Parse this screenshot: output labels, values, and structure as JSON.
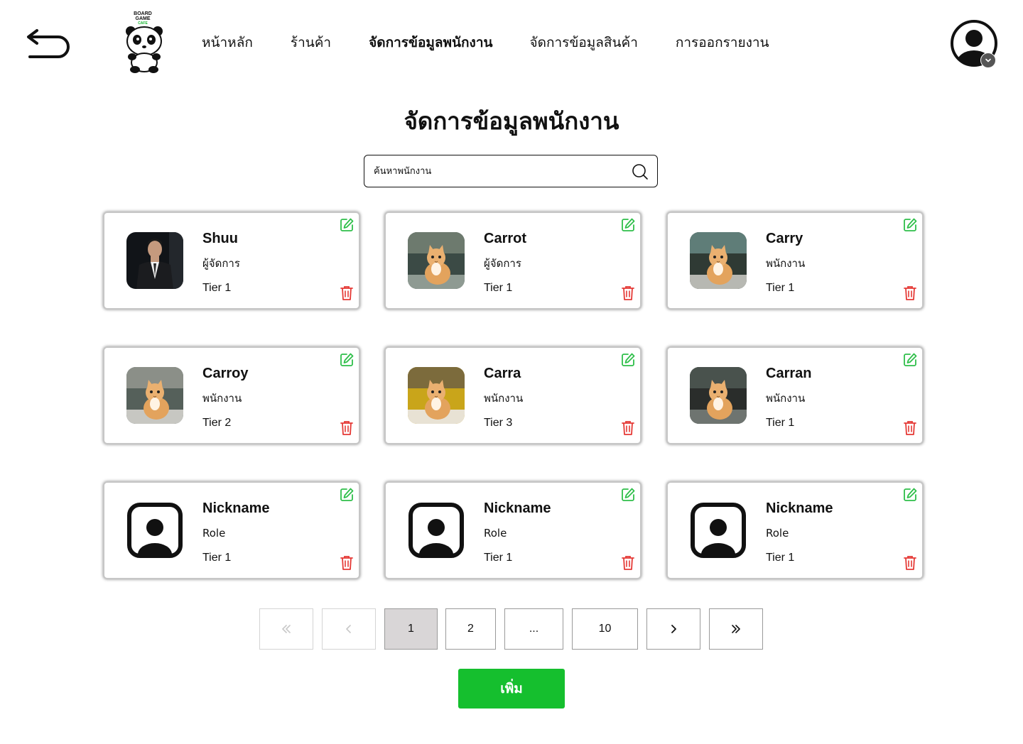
{
  "nav": {
    "items": [
      {
        "label": "หน้าหลัก",
        "active": false
      },
      {
        "label": "ร้านค้า",
        "active": false
      },
      {
        "label": "จัดการข้อมูลพนักงาน",
        "active": true
      },
      {
        "label": "จัดการข้อมูลสินค้า",
        "active": false
      },
      {
        "label": "การออกรายงาน",
        "active": false
      }
    ]
  },
  "logo": {
    "line1": "BOARD",
    "line2": "GAME",
    "line3": "CAFE"
  },
  "page": {
    "title": "จัดการข้อมูลพนักงาน"
  },
  "search": {
    "placeholder": "ค้นหาพนักงาน",
    "value": ""
  },
  "employees": [
    {
      "nickname": "Shuu",
      "role": "ผู้จัดการ",
      "tier": "Tier 1",
      "photo": "person"
    },
    {
      "nickname": "Carrot",
      "role": "ผู้จัดการ",
      "tier": "Tier 1",
      "photo": "cat"
    },
    {
      "nickname": "Carry",
      "role": "พนักงาน",
      "tier": "Tier 1",
      "photo": "cat"
    },
    {
      "nickname": "Carroy",
      "role": "พนักงาน",
      "tier": "Tier 2",
      "photo": "cat"
    },
    {
      "nickname": "Carra",
      "role": "พนักงาน",
      "tier": "Tier 3",
      "photo": "cat"
    },
    {
      "nickname": "Carran",
      "role": "พนักงาน",
      "tier": "Tier 1",
      "photo": "cat"
    },
    {
      "nickname": "Nickname",
      "role": "Role",
      "tier": "Tier 1",
      "photo": "placeholder"
    },
    {
      "nickname": "Nickname",
      "role": "Role",
      "tier": "Tier 1",
      "photo": "placeholder"
    },
    {
      "nickname": "Nickname",
      "role": "Role",
      "tier": "Tier 1",
      "photo": "placeholder"
    }
  ],
  "pagination": {
    "first": "«",
    "prev": "‹",
    "pages": [
      "1",
      "2",
      "...",
      "10"
    ],
    "current": "1",
    "next": "›",
    "last": "»"
  },
  "actions": {
    "add_label": "เพิ่ม"
  },
  "colors": {
    "accent": "#15bf2e",
    "edit": "#2fbf4a",
    "delete": "#e53935",
    "current_page": "#d9d6d7"
  }
}
